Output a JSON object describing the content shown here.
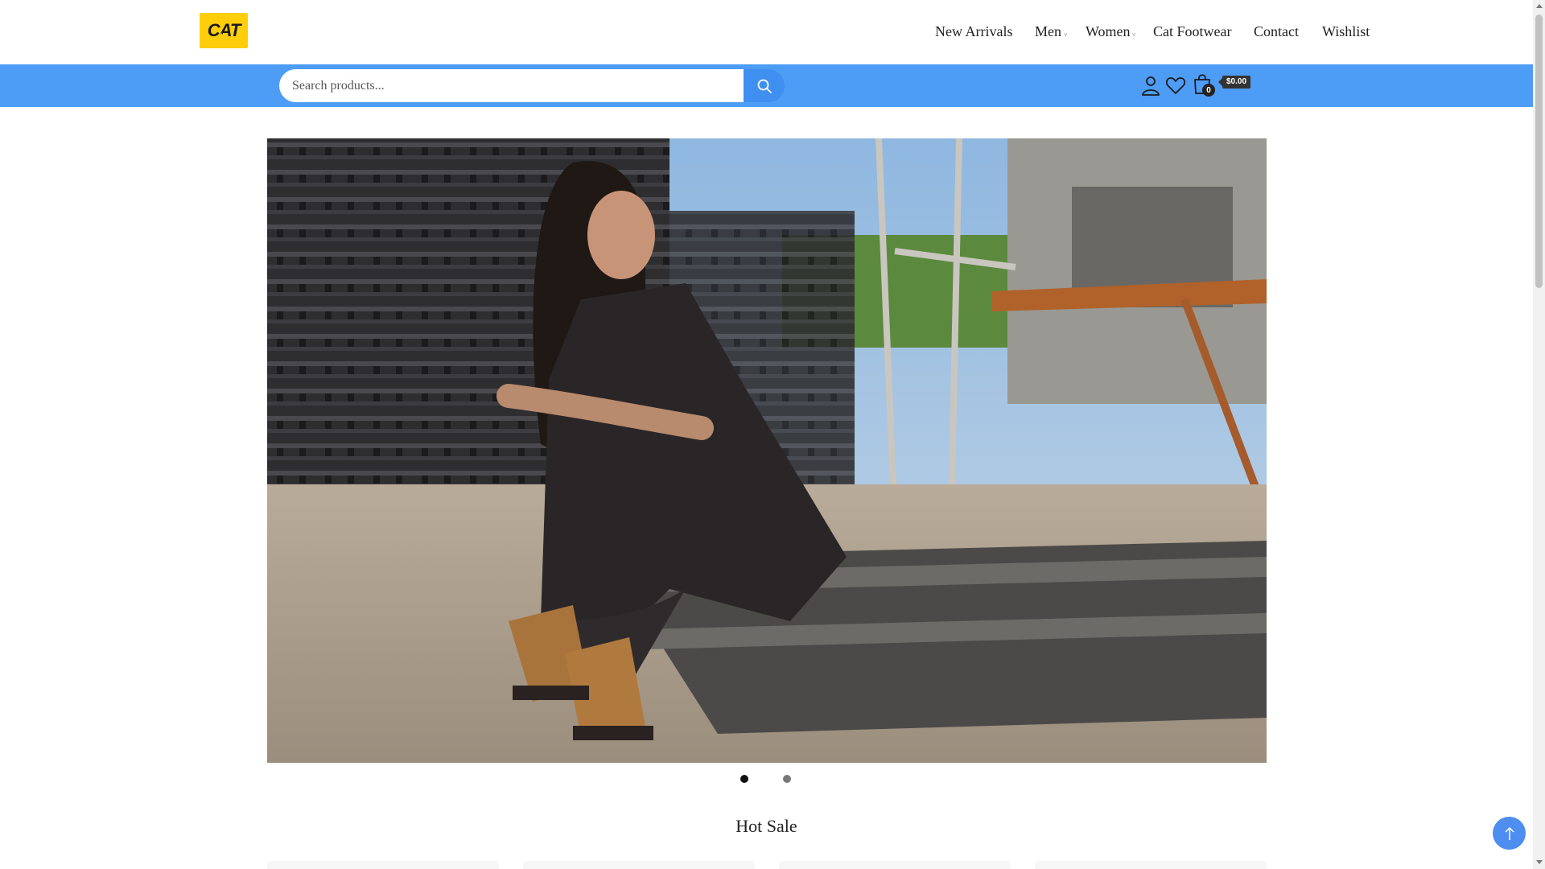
{
  "header": {
    "logo_text": "CAT",
    "nav": [
      {
        "label": "New Arrivals"
      },
      {
        "label": "Men",
        "caret": "˅"
      },
      {
        "label": "Women",
        "caret": "˅"
      },
      {
        "label": "Cat Footwear"
      },
      {
        "label": "Contact"
      },
      {
        "label": "Wishlist"
      }
    ]
  },
  "search": {
    "placeholder": "Search products...",
    "button_icon": "search-icon"
  },
  "user_actions": {
    "account_icon": "user-icon",
    "wishlist_icon": "heart-icon",
    "cart_icon": "shopping-bag-icon",
    "cart_count": "0",
    "cart_total": "$0.00"
  },
  "hero": {
    "slide_count": 2,
    "active_slide": 1
  },
  "sections": {
    "hot_sale_title": "Hot Sale"
  },
  "colors": {
    "brand_yellow": "#fece0a",
    "header_blue": "#4d9cf6",
    "search_button_blue": "#3f8ff0",
    "back_to_top_blue": "#4d8ef0"
  },
  "back_to_top_icon": "arrow-up-icon"
}
